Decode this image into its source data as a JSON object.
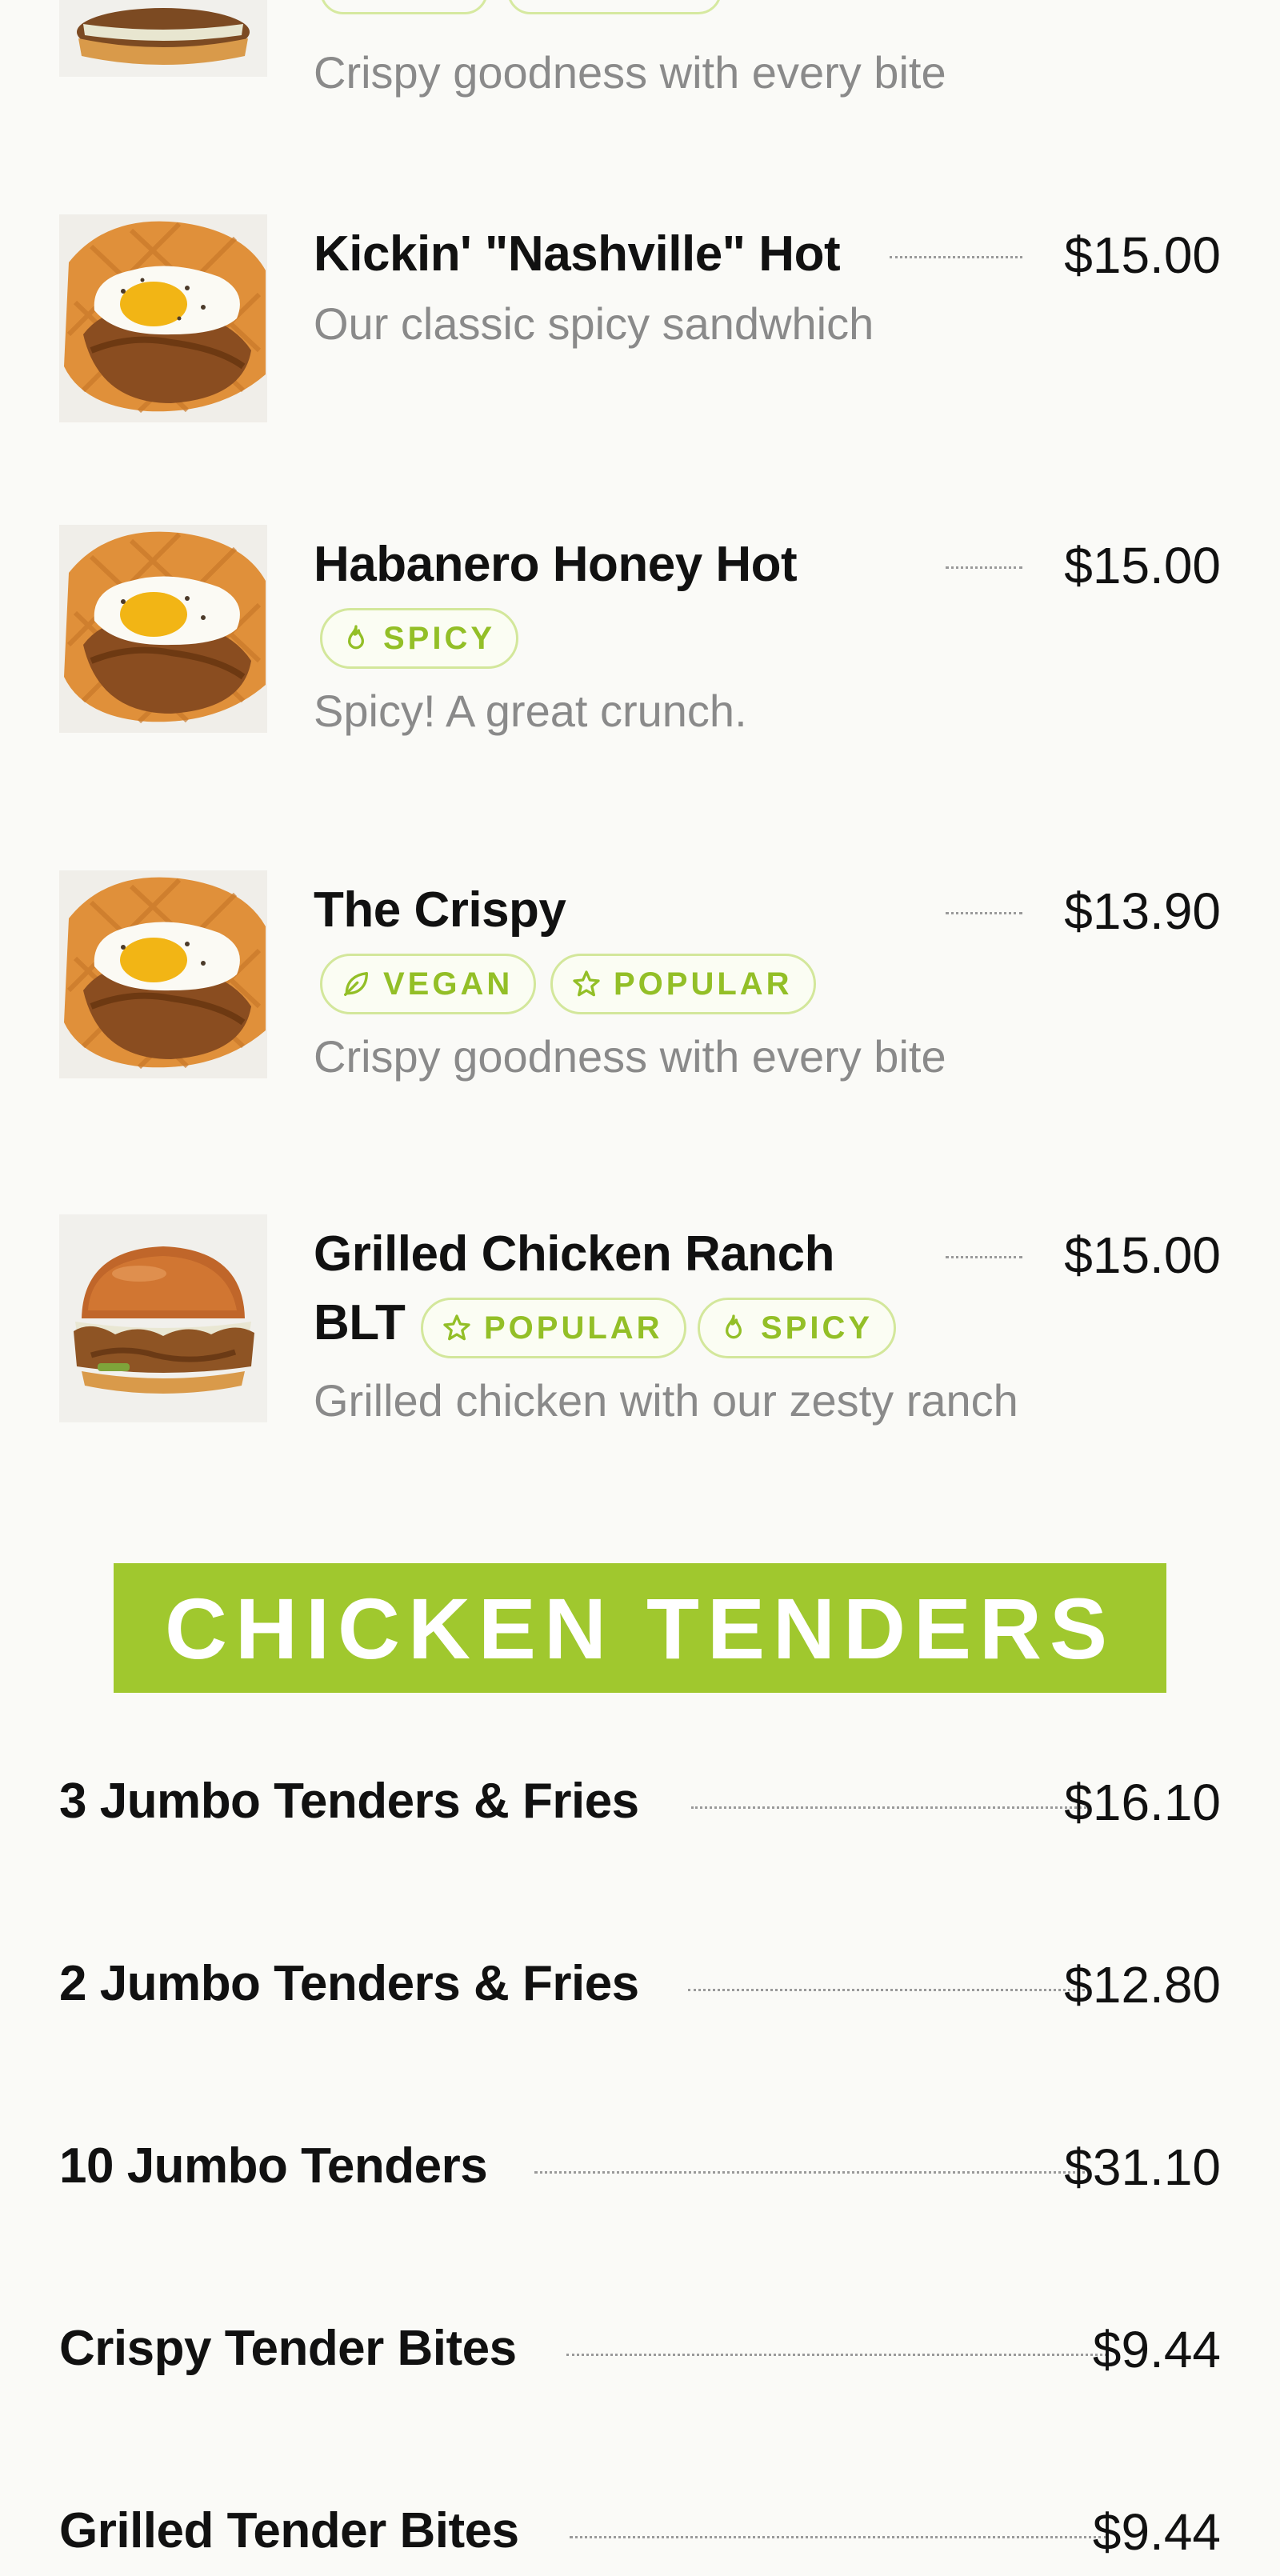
{
  "partial_item": {
    "description": "Crispy goodness with every bite"
  },
  "items": [
    {
      "name": "Kickin' \"Nashville\" Hot",
      "price": "$15.00",
      "badges": [],
      "description": "Our classic spicy sandwhich",
      "image": "waffle-chicken-photo"
    },
    {
      "name": "Habanero Honey Hot",
      "price": "$15.00",
      "badges": [
        {
          "label": "SPICY",
          "icon": "flame-icon"
        }
      ],
      "description": "Spicy! A great crunch.",
      "image": "waffle-chicken-photo"
    },
    {
      "name": "The Crispy",
      "price": "$13.90",
      "badges": [
        {
          "label": "VEGAN",
          "icon": "leaf-icon"
        },
        {
          "label": "POPULAR",
          "icon": "star-icon"
        }
      ],
      "description": "Crispy goodness with every bite",
      "image": "waffle-chicken-photo"
    },
    {
      "name_line1": "Grilled Chicken Ranch",
      "name_line2": "BLT",
      "price": "$15.00",
      "badges": [
        {
          "label": "POPULAR",
          "icon": "star-icon"
        },
        {
          "label": "SPICY",
          "icon": "flame-icon"
        }
      ],
      "description": "Grilled chicken with our zesty ranch",
      "image": "chicken-sandwich-photo"
    }
  ],
  "section": {
    "title": "CHICKEN TENDERS"
  },
  "tenders": [
    {
      "name": "3 Jumbo Tenders & Fries",
      "price": "$16.10"
    },
    {
      "name": "2 Jumbo Tenders & Fries",
      "price": "$12.80"
    },
    {
      "name": "10 Jumbo Tenders",
      "price": "$31.10"
    },
    {
      "name": "Crispy Tender Bites",
      "price": "$9.44"
    },
    {
      "name": "Grilled Tender Bites",
      "price": "$9.44"
    }
  ],
  "colors": {
    "accent": "#a0c82e",
    "badge_text": "#93bf27",
    "badge_border": "#d3e79b",
    "description": "#8a8a8a",
    "background": "#fafaf7"
  }
}
